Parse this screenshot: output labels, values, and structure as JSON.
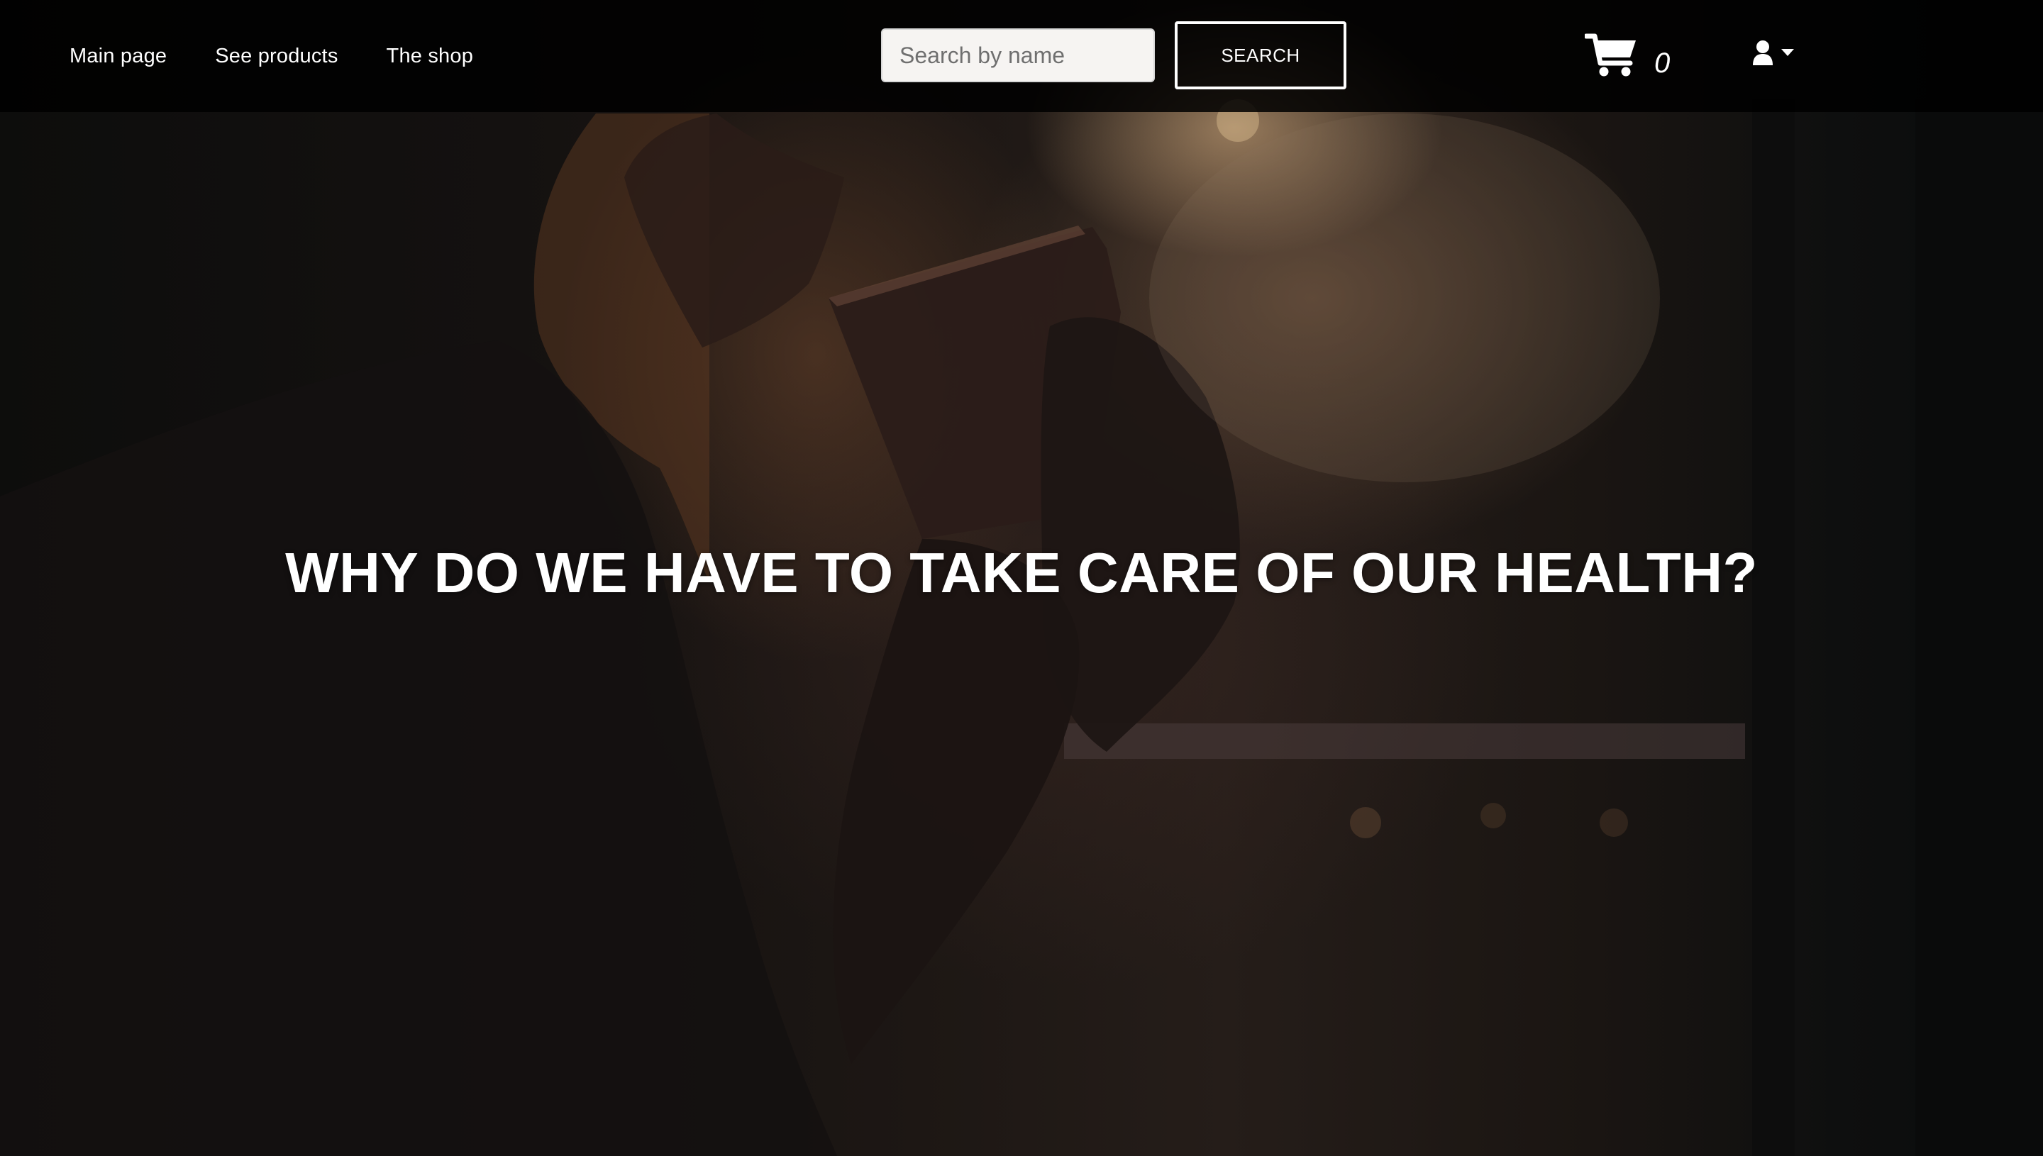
{
  "navbar": {
    "links": [
      {
        "label": "Main page"
      },
      {
        "label": "See products"
      },
      {
        "label": "The shop"
      }
    ],
    "search": {
      "placeholder": "Search by name",
      "value": "",
      "button_label": "SEARCH"
    },
    "cart": {
      "icon": "shopping-cart-icon",
      "count": "0"
    },
    "user_menu": {
      "icon": "user-icon",
      "dropdown_icon": "caret-down-icon"
    }
  },
  "hero": {
    "headline": "WHY DO WE HAVE TO TAKE CARE OF OUR HEALTH?",
    "image": "woman-drinking-coffee-photo"
  },
  "colors": {
    "navbar_bg": "#000000",
    "text": "#ffffff",
    "hero_tone": "#2a1f1a"
  }
}
